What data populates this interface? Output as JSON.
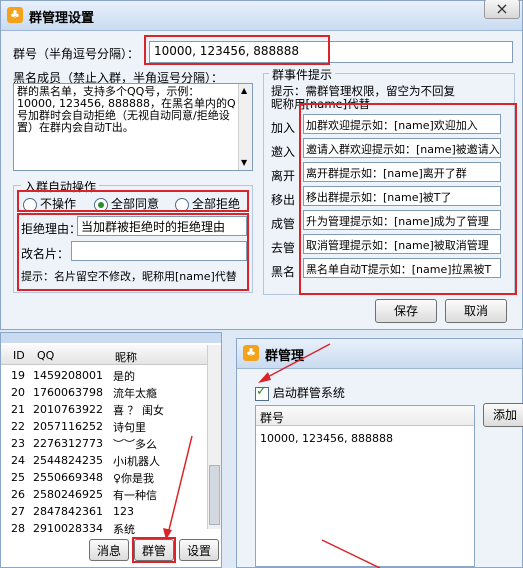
{
  "main": {
    "title": "群管理设置",
    "group_no_label": "群号（半角逗号分隔）：",
    "group_no_value": "10000, 123456, 888888",
    "blacklist_label": "黑名成员（禁止入群，半角逗号分隔）：",
    "blacklist_text": "群的黑名单，支持多个QQ号，示例：10000, 123456, 888888，在黑名单内的Q号加群时会自动拒绝（无视自动同意/拒绝设置）在群内会自动T出。",
    "auto_join": {
      "legend": "入群自动操作",
      "options": [
        "不操作",
        "全部同意",
        "全部拒绝"
      ],
      "selected": "全部同意",
      "reject_label": "拒绝理由：",
      "reject_value": "当加群被拒绝时的拒绝理由",
      "rename_label": "改名片：",
      "rename_value": "",
      "hint": "提示：名片留空不修改，昵称用[name]代替"
    },
    "events": {
      "legend": "群事件提示",
      "hint_line1": "提示：需群管理权限，留空为不回复",
      "hint_line2": "昵称用[name]代替",
      "rows": [
        {
          "label": "加入",
          "value": "加群欢迎提示如：[name]欢迎加入"
        },
        {
          "label": "邀入",
          "value": "邀请入群欢迎提示如：[name]被邀请入"
        },
        {
          "label": "离开",
          "value": "离开群提示如：[name]离开了群"
        },
        {
          "label": "移出",
          "value": "移出群提示如：[name]被T了"
        },
        {
          "label": "成管",
          "value": "升为管理提示如：[name]成为了管理"
        },
        {
          "label": "去管",
          "value": "取消管理提示如：[name]被取消管理"
        },
        {
          "label": "黑名",
          "value": "黑名单自动T提示如：[name]拉黑被T"
        }
      ]
    },
    "save_label": "保存",
    "cancel_label": "取消"
  },
  "list": {
    "headers": [
      "ID",
      "QQ",
      "昵称"
    ],
    "rows": [
      [
        "19",
        "1459208001",
        "是的"
      ],
      [
        "20",
        "1760063798",
        "流年太瘾"
      ],
      [
        "21",
        "2010763922",
        "喜 ？ 闺女"
      ],
      [
        "22",
        "2057116252",
        "诗句里"
      ],
      [
        "23",
        "2276312773",
        "︶︶多么"
      ],
      [
        "24",
        "2544824235",
        "小i机器人"
      ],
      [
        "25",
        "2550669348",
        "♀你是我"
      ],
      [
        "26",
        "2580246925",
        "有一种信"
      ],
      [
        "27",
        "2847842361",
        "123"
      ],
      [
        "28",
        "2910028334",
        "系统"
      ]
    ],
    "buttons": [
      "消息",
      "群管",
      "设置"
    ]
  },
  "second": {
    "title": "群管理",
    "checkbox_label": "启动群管系统",
    "checked": true,
    "col_header": "群号",
    "group_value": "10000, 123456, 888888",
    "add_label": "添加"
  },
  "colors": {
    "highlight": "#d9252a",
    "window_bg": "#eef3fa",
    "title_bg": "#c9dbf0"
  }
}
